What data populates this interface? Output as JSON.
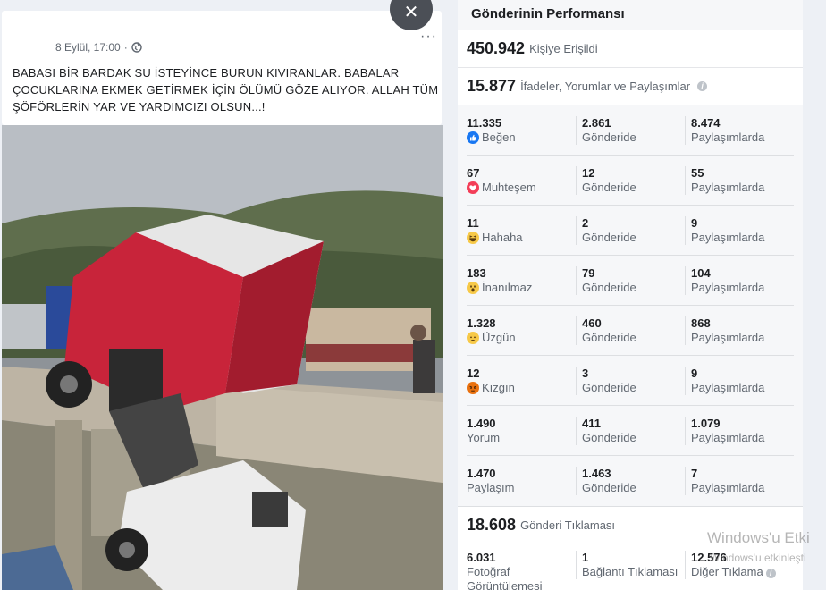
{
  "post": {
    "date": "8 Eylül, 17:00",
    "separator": "·",
    "text": "BABASI BİR BARDAK SU İSTEYİNCE BURUN KIVIRANLAR. BABALAR ÇOCUKLARINA EKMEK GETİRMEK İÇİN ÖLÜMÜ GÖZE ALIYOR. ALLAH TÜM ŞÖFÖRLERİN YAR VE YARDIMCIZI OLSUN...!",
    "more_label": "···",
    "close_label": "✕"
  },
  "panel": {
    "title": "Gönderinin Performansı",
    "reach_value": "450.942",
    "reach_label": "Kişiye Erişildi",
    "engagement_value": "15.877",
    "engagement_label": "İfadeler, Yorumlar ve Paylaşımlar",
    "rows": [
      {
        "total": "11.335",
        "name": "Beğen",
        "icon": "like-icon",
        "post": "2.861",
        "post_label": "Gönderide",
        "shares": "8.474",
        "shares_label": "Paylaşımlarda"
      },
      {
        "total": "67",
        "name": "Muhteşem",
        "icon": "love-icon",
        "post": "12",
        "post_label": "Gönderide",
        "shares": "55",
        "shares_label": "Paylaşımlarda"
      },
      {
        "total": "11",
        "name": "Hahaha",
        "icon": "haha-icon",
        "post": "2",
        "post_label": "Gönderide",
        "shares": "9",
        "shares_label": "Paylaşımlarda"
      },
      {
        "total": "183",
        "name": "İnanılmaz",
        "icon": "wow-icon",
        "post": "79",
        "post_label": "Gönderide",
        "shares": "104",
        "shares_label": "Paylaşımlarda"
      },
      {
        "total": "1.328",
        "name": "Üzgün",
        "icon": "sad-icon",
        "post": "460",
        "post_label": "Gönderide",
        "shares": "868",
        "shares_label": "Paylaşımlarda"
      },
      {
        "total": "12",
        "name": "Kızgın",
        "icon": "angry-icon",
        "post": "3",
        "post_label": "Gönderide",
        "shares": "9",
        "shares_label": "Paylaşımlarda"
      },
      {
        "total": "1.490",
        "name": "Yorum",
        "icon": "",
        "post": "411",
        "post_label": "Gönderide",
        "shares": "1.079",
        "shares_label": "Paylaşımlarda"
      },
      {
        "total": "1.470",
        "name": "Paylaşım",
        "icon": "",
        "post": "1.463",
        "post_label": "Gönderide",
        "shares": "7",
        "shares_label": "Paylaşımlarda"
      }
    ],
    "clicks_value": "18.608",
    "clicks_label": "Gönderi Tıklaması",
    "clicks": [
      {
        "value": "6.031",
        "label": "Fotoğraf Görüntülemesi"
      },
      {
        "value": "1",
        "label": "Bağlantı Tıklaması"
      },
      {
        "value": "12.576",
        "label": "Diğer Tıklama"
      }
    ]
  },
  "watermark": {
    "line1": "Windows'u Etki",
    "line2": "Windows'u etkinleşti"
  },
  "colors": {
    "like": "#1877f2",
    "love": "#f33e58",
    "emoji_yellow": "#f7c948",
    "angry": "#e9710f"
  }
}
